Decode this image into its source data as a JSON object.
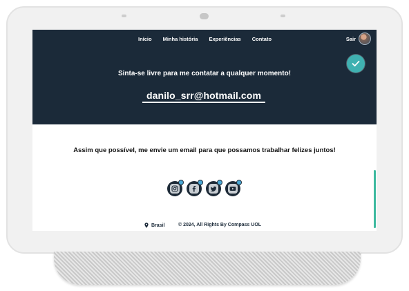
{
  "nav": {
    "items": [
      {
        "label": "Início"
      },
      {
        "label": "Minha história"
      },
      {
        "label": "Experiências"
      },
      {
        "label": "Contato"
      }
    ],
    "logout_label": "Sair"
  },
  "hero": {
    "title": "Sinta-se livre para me contatar a qualquer momento!",
    "email": "danilo_srr@hotmail.com"
  },
  "message": "Assim que possível, me envie um email para que possamos trabalhar felizes juntos!",
  "socials": [
    {
      "icon": "instagram-icon"
    },
    {
      "icon": "facebook-icon"
    },
    {
      "icon": "twitter-icon"
    },
    {
      "icon": "youtube-icon"
    }
  ],
  "footer": {
    "location": "Brasil",
    "copyright": "© 2024, All Rights By Compass UOL"
  },
  "colors": {
    "hero_bg": "#1b2a39",
    "accent": "#3fb1b1",
    "scroll_accent": "#3dba9f"
  }
}
